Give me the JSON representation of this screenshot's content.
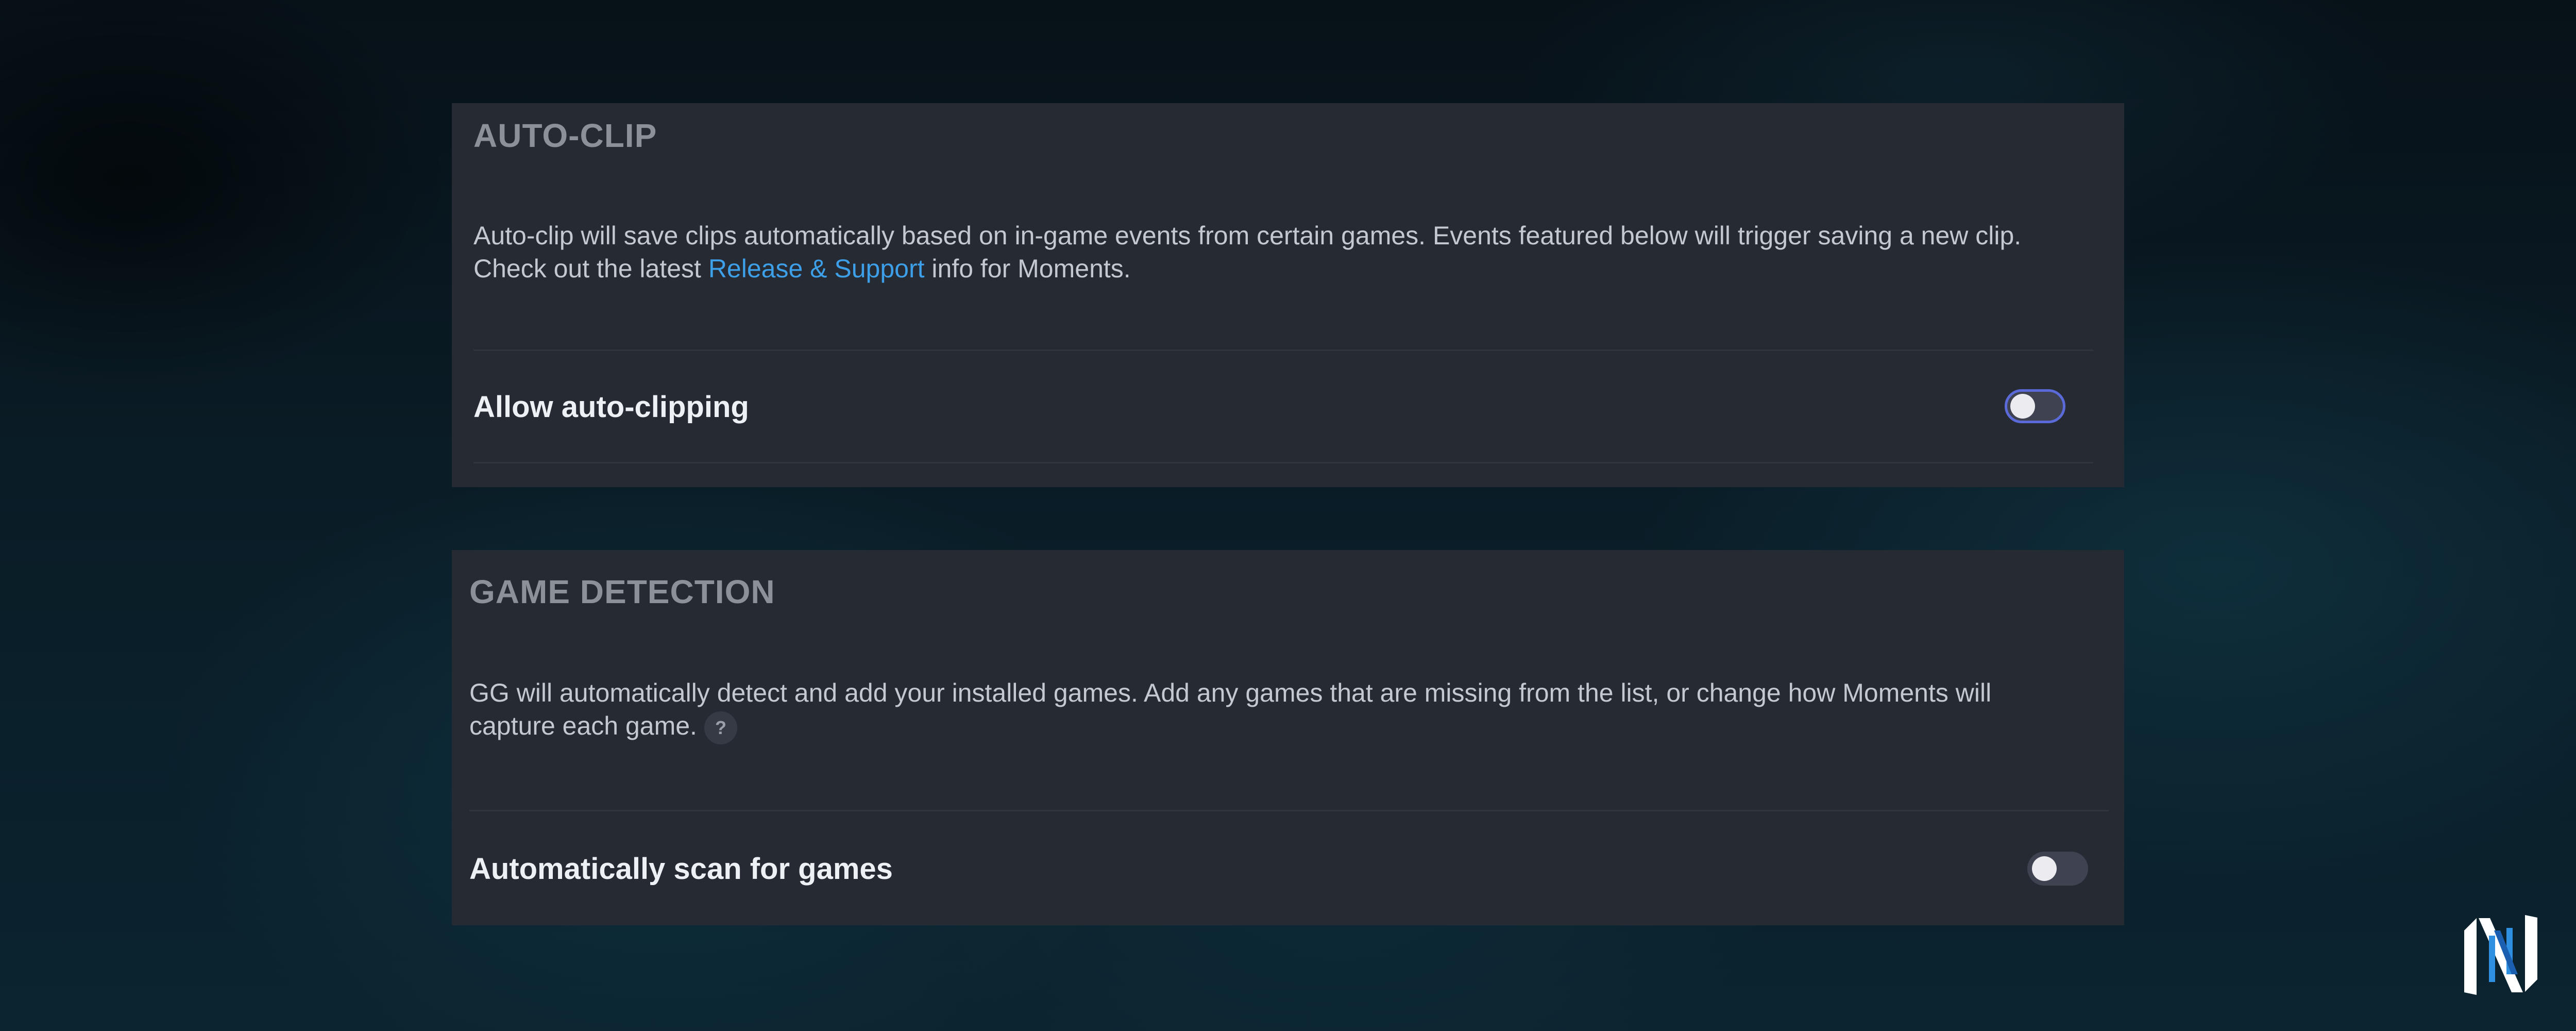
{
  "auto_clip": {
    "title": "AUTO-CLIP",
    "description_before_link": "Auto-clip will save clips automatically based on in-game events from certain games. Events featured below will trigger saving a new clip. Check out the latest ",
    "link_text": "Release & Support",
    "description_after_link": " info for Moments.",
    "setting_label": "Allow auto-clipping",
    "toggle_on": false
  },
  "game_detection": {
    "title": "GAME DETECTION",
    "description": "GG will automatically detect and add your installed games. Add any games that are missing from the list, or change how Moments will capture each game.",
    "help_icon_glyph": "?",
    "setting_label": "Automatically scan for games",
    "toggle_on": false
  },
  "colors": {
    "panel_bg": "#262a33",
    "link": "#3d9fe8",
    "toggle_focus_ring": "#5a6ad8"
  },
  "icons": {
    "help": "help-icon",
    "brand_logo": "brand-logo-icon"
  }
}
